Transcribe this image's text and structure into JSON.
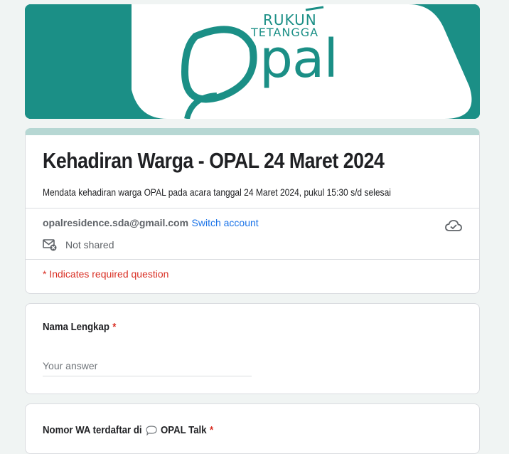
{
  "banner": {
    "logo_line1": "RUKUN",
    "logo_line2": "TETANGGA",
    "logo_main": "pal",
    "colors": {
      "teal": "#1b8f86",
      "white": "#ffffff"
    }
  },
  "form": {
    "title": "Kehadiran Warga - OPAL 24 Maret 2024",
    "description": "Mendata kehadiran warga OPAL pada acara tanggal 24 Maret 2024, pukul 15:30 s/d selesai",
    "accent_color": "#b6d7d3"
  },
  "account": {
    "email": "opalresidence.sda@gmail.com",
    "switch_label": "Switch account",
    "shared_status": "Not shared",
    "shared_icon": "mail-off-icon",
    "save_status_icon": "cloud-check-icon"
  },
  "required_note": "* Indicates required question",
  "questions": [
    {
      "label": "Nama Lengkap",
      "required_mark": "*",
      "placeholder": "Your answer"
    },
    {
      "label_prefix": "Nomor WA terdaftar di",
      "label_icon": "speech-bubble-icon",
      "label_suffix": "OPAL Talk",
      "required_mark": "*"
    }
  ]
}
